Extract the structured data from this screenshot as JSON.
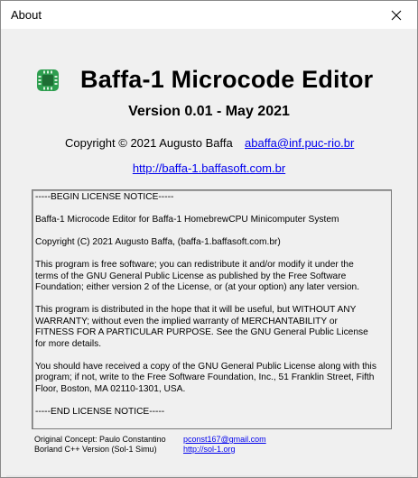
{
  "window": {
    "title": "About"
  },
  "app": {
    "name": "Baffa-1 Microcode Editor",
    "version_line": "Version 0.01 - May 2021",
    "copyright": "Copyright © 2021 Augusto Baffa",
    "email": "abaffa@inf.puc-rio.br",
    "website": "http://baffa-1.baffasoft.com.br"
  },
  "license": {
    "paragraphs": [
      "-----BEGIN LICENSE NOTICE-----",
      "Baffa-1 Microcode Editor for Baffa-1 HomebrewCPU Minicomputer System",
      "Copyright (C) 2021 Augusto Baffa, (baffa-1.baffasoft.com.br)",
      "This program is free software; you can redistribute it and/or modify it under the terms of the GNU General Public License as published by the Free Software Foundation; either version 2 of the License, or (at your option) any later version.",
      "This program is distributed in the hope that it will be useful, but WITHOUT ANY WARRANTY; without even the implied warranty of MERCHANTABILITY or FITNESS FOR A PARTICULAR PURPOSE. See the GNU General Public License for more details.",
      "You should have received a copy of the GNU General Public License along with this program; if not, write to the Free Software Foundation, Inc., 51 Franklin Street, Fifth Floor, Boston, MA 02110-1301, USA.",
      "-----END LICENSE NOTICE-----"
    ]
  },
  "credits": {
    "original_label": "Original Concept: Paulo Constantino",
    "original_email": "pconst167@gmail.com",
    "borland_label": "Borland C++ Version (Sol-1 Simu)",
    "borland_link": "http://sol-1.org"
  },
  "icons": {
    "app": "chip-icon",
    "close": "close-icon"
  },
  "colors": {
    "link": "#0000ee",
    "chip_body": "#2e9e4f",
    "chip_pins": "#1e6e34"
  }
}
